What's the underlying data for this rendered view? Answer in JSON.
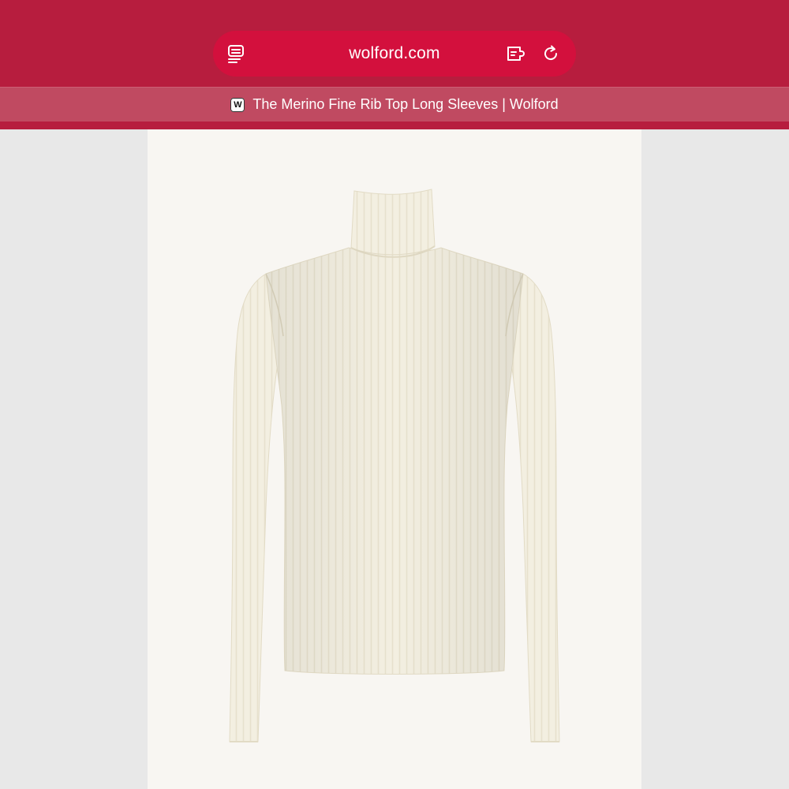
{
  "browser": {
    "url": "wolford.com",
    "tab": {
      "favicon_letter": "W",
      "title": "The Merino Fine Rib Top Long Sleeves | Wolford"
    },
    "icons": {
      "reader": "reader-mode-icon",
      "extensions": "extensions-icon",
      "reload": "reload-icon"
    },
    "colors": {
      "chrome": "#b71d3e",
      "address_bar": "#d3103d",
      "tab_strip": "#c04a61"
    }
  },
  "product": {
    "image": "cream-ribbed-turtleneck-long-sleeve-top",
    "garment_color": "#f3efe1"
  }
}
